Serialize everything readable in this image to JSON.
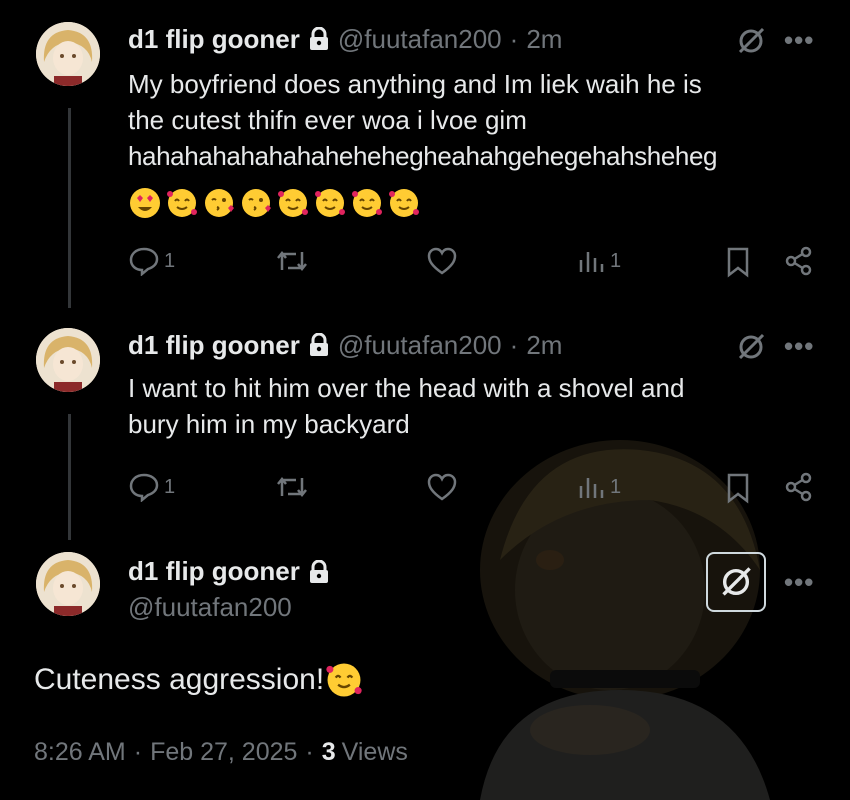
{
  "tweets": [
    {
      "name": "d1 flip gooner",
      "handle": "@fuutafan200",
      "time": "2m",
      "text_lines": [
        "My boyfriend does anything and Im liek waih he is",
        "the cutest thifn ever woa i lvoe gim",
        "hahahahahahahaheheheghea hahgehegehahsheheg"
      ],
      "emojis": [
        "heart-eyes",
        "smiling-hearts",
        "kissing-heart",
        "kissing-heart",
        "smiling-hearts",
        "smiling-hearts",
        "smiling-hearts",
        "smiling-hearts"
      ],
      "replies": "1",
      "views": "1"
    },
    {
      "name": "d1 flip gooner",
      "handle": "@fuutafan200",
      "time": "2m",
      "text_lines": [
        "I want to hit him over the head with a shovel and",
        "bury him in my backyard"
      ],
      "replies": "1",
      "views": "1"
    }
  ],
  "main_tweet": {
    "name": "d1 flip gooner",
    "handle": "@fuutafan200",
    "text": "Cuteness aggression!",
    "time": "8:26 AM",
    "date": "Feb 27, 2025",
    "views_count": "3",
    "views_label": "Views"
  },
  "separator": "·",
  "colors": {
    "background": "#000000",
    "text": "#e7e9ea",
    "muted": "#71767b",
    "line": "#333639"
  },
  "icons": [
    "lock-icon",
    "grok-icon",
    "more-icon",
    "reply-icon",
    "retweet-icon",
    "like-icon",
    "views-icon",
    "bookmark-icon",
    "share-icon"
  ]
}
